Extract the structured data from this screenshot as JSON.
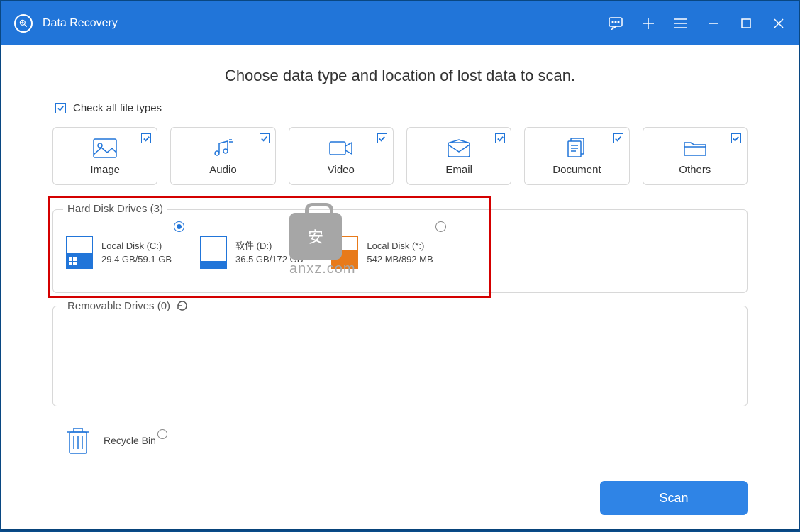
{
  "titlebar": {
    "title": "Data Recovery"
  },
  "heading": "Choose data type and location of lost data to scan.",
  "check_all_label": "Check all file types",
  "file_types": [
    {
      "label": "Image"
    },
    {
      "label": "Audio"
    },
    {
      "label": "Video"
    },
    {
      "label": "Email"
    },
    {
      "label": "Document"
    },
    {
      "label": "Others"
    }
  ],
  "hdd_section_title": "Hard Disk Drives (3)",
  "drives": [
    {
      "name": "Local Disk (C:)",
      "size": "29.4 GB/59.1 GB",
      "fill_pct": 50,
      "selected": true,
      "win": true
    },
    {
      "name": "软件 (D:)",
      "size": "36.5 GB/172 GB",
      "fill_pct": 22,
      "selected": false,
      "win": false
    },
    {
      "name": "Local Disk (*:)",
      "size": "542 MB/892 MB",
      "fill_pct": 60,
      "selected": false,
      "win": false,
      "orange": true
    }
  ],
  "removable_section_title": "Removable Drives (0)",
  "recycle_label": "Recycle Bin",
  "scan_label": "Scan",
  "watermark": {
    "char": "安",
    "text": "anxz.com"
  }
}
